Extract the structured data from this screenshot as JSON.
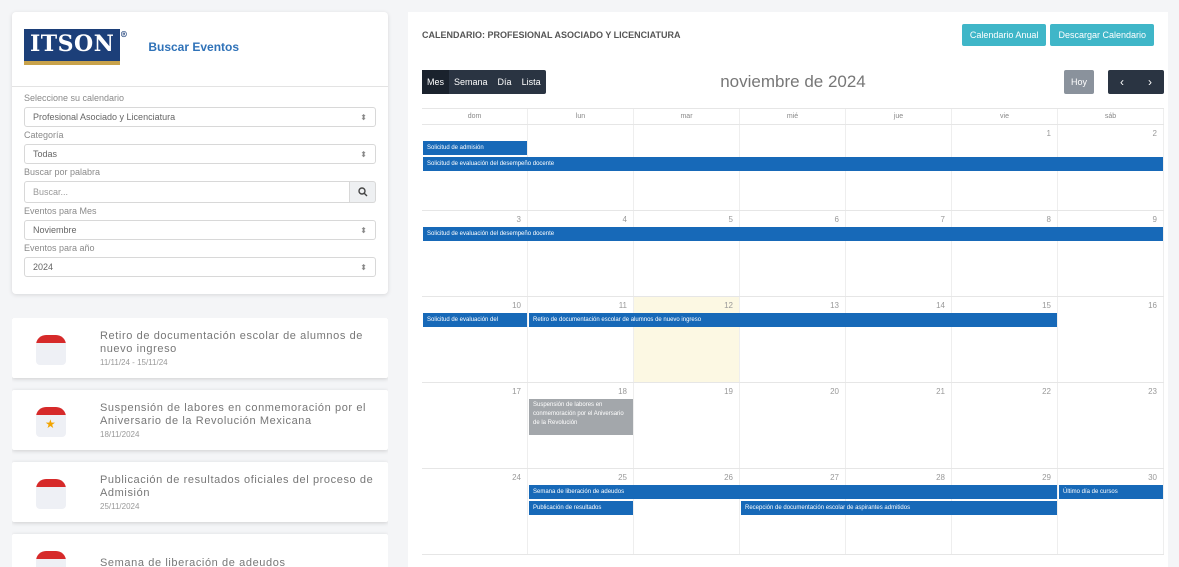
{
  "brand": {
    "logo": "ITSON",
    "reg": "®",
    "search_title": "Buscar Eventos"
  },
  "filters": [
    {
      "label": "Seleccione su calendario",
      "value": "Profesional Asociado y Licenciatura",
      "kind": "select"
    },
    {
      "label": "Categoría",
      "value": "Todas",
      "kind": "select"
    },
    {
      "label": "Buscar por palabra",
      "value": "Buscar...",
      "kind": "search"
    },
    {
      "label": "Eventos para Mes",
      "value": "Noviembre",
      "kind": "select"
    },
    {
      "label": "Eventos para año",
      "value": "2024",
      "kind": "select"
    }
  ],
  "event_list": [
    {
      "title": "Retiro de documentación escolar de alumnos de nuevo ingreso",
      "date": "11/11/24 - 15/11/24",
      "icon": "calendar-icon"
    },
    {
      "title": "Suspensión de labores en conmemoración por el Aniversario de la Revolución Mexicana",
      "date": "18/11/2024",
      "icon": "calendar-star-icon"
    },
    {
      "title": "Publicación de resultados oficiales del proceso de Admisión",
      "date": "25/11/2024",
      "icon": "calendar-icon"
    },
    {
      "title": "Semana de liberación de adeudos",
      "date": "",
      "icon": "calendar-icon"
    }
  ],
  "header": {
    "title": "CALENDARIO: PROFESIONAL ASOCIADO Y LICENCIATURA",
    "btn_annual": "Calendario Anual",
    "btn_download": "Descargar Calendario"
  },
  "toolbar": {
    "views": [
      "Mes",
      "Semana",
      "Día",
      "Lista"
    ],
    "active_view": "Mes",
    "month_title": "noviembre de 2024",
    "today": "Hoy",
    "prev": "‹",
    "next": "›"
  },
  "calendar": {
    "dow": [
      "dom",
      "lun",
      "mar",
      "mié",
      "jue",
      "vie",
      "sáb"
    ],
    "weeks": [
      {
        "days": [
          "",
          "",
          "",
          "",
          "",
          "1",
          "2"
        ]
      },
      {
        "days": [
          "3",
          "4",
          "5",
          "6",
          "7",
          "8",
          "9"
        ]
      },
      {
        "days": [
          "10",
          "11",
          "12",
          "13",
          "14",
          "15",
          "16"
        ]
      },
      {
        "days": [
          "17",
          "18",
          "19",
          "20",
          "21",
          "22",
          "23"
        ]
      },
      {
        "days": [
          "24",
          "25",
          "26",
          "27",
          "28",
          "29",
          "30"
        ]
      }
    ],
    "today_day": "12",
    "events": [
      {
        "week": 0,
        "start": 0,
        "span": 1,
        "row": 0,
        "label": "Solicitud de admisión",
        "style": "blue"
      },
      {
        "week": 0,
        "start": 0,
        "span": 7,
        "row": 1,
        "label": "Solicitud de evaluación del desempeño docente",
        "style": "blue"
      },
      {
        "week": 1,
        "start": 0,
        "span": 7,
        "row": 0,
        "label": "Solicitud de evaluación del desempeño docente",
        "style": "blue"
      },
      {
        "week": 2,
        "start": 0,
        "span": 1,
        "row": 0,
        "label": "Solicitud de evaluación del",
        "style": "blue"
      },
      {
        "week": 2,
        "start": 1,
        "span": 5,
        "row": 0,
        "label": "Retiro de documentación escolar de alumnos de nuevo ingreso",
        "style": "blue"
      },
      {
        "week": 3,
        "start": 1,
        "span": 1,
        "row": 0,
        "label": "Suspensión de labores en conmemoración por el Aniversario de la Revolución",
        "style": "gray"
      },
      {
        "week": 4,
        "start": 1,
        "span": 5,
        "row": 0,
        "label": "Semana de liberación de adeudos",
        "style": "blue"
      },
      {
        "week": 4,
        "start": 6,
        "span": 1,
        "row": 0,
        "label": "Último día de cursos",
        "style": "blue"
      },
      {
        "week": 4,
        "start": 1,
        "span": 1,
        "row": 1,
        "label": "Publicación de resultados",
        "style": "blue"
      },
      {
        "week": 4,
        "start": 3,
        "span": 3,
        "row": 1,
        "label": "Recepción de documentación escolar de aspirantes admitidos",
        "style": "blue"
      }
    ]
  },
  "colors": {
    "accent": "#3fb6c8",
    "event": "#1769b8",
    "dark": "#2a3442",
    "brand": "#1c3f79"
  }
}
